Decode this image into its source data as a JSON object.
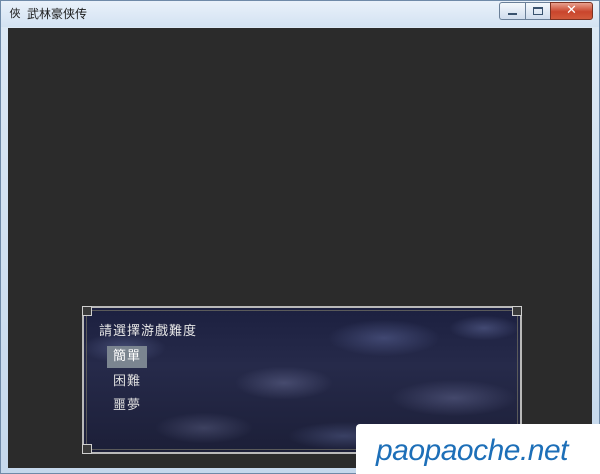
{
  "window": {
    "icon_glyph": "俠",
    "title": "武林豪侠传",
    "minimize_glyph": "",
    "maximize_glyph": "",
    "close_glyph": "✕"
  },
  "dialog": {
    "prompt": "請選擇游戲難度",
    "options": [
      {
        "label": "簡單",
        "selected": true
      },
      {
        "label": "困難",
        "selected": false
      },
      {
        "label": "噩夢",
        "selected": false
      }
    ]
  },
  "watermark": {
    "text": "paopaoche.net"
  },
  "colors": {
    "client_bg": "#2b2b2b",
    "selection_bg": "#7b8590",
    "watermark_text": "#1d6fb8"
  }
}
